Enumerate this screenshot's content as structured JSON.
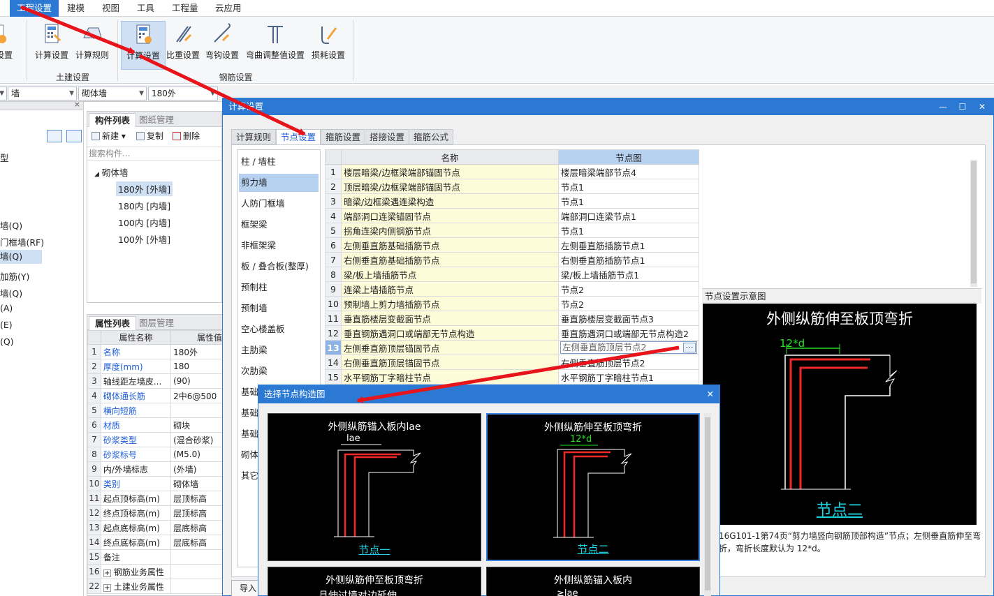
{
  "menu": [
    "工程设置",
    "建模",
    "视图",
    "工具",
    "工程量",
    "云应用"
  ],
  "ribbon": {
    "partial_left_label": "设置",
    "civil_buttons": [
      "计算设置",
      "计算规则"
    ],
    "rebar_buttons": [
      "计算设置",
      "比重设置",
      "弯钩设置",
      "弯曲调整值设置",
      "损耗设置"
    ],
    "group_civil": "土建设置",
    "group_rebar": "钢筋设置"
  },
  "combos": [
    "墙",
    "砌体墙",
    "180外"
  ],
  "left_nav": {
    "items": [
      "型",
      "墙(Q)",
      "门框墙(RF)",
      "墙(Q)",
      "加筋(Y)",
      "墙(Q)",
      "(A)",
      "(E)",
      "(Q)"
    ],
    "selected_index": 3
  },
  "component_list": {
    "tabs": [
      "构件列表",
      "图纸管理"
    ],
    "toolbar": [
      "新建",
      "复制",
      "删除"
    ],
    "search_placeholder": "搜索构件...",
    "root": "砌体墙",
    "items": [
      "180外 [外墙]",
      "180内 [内墙]",
      "100内 [内墙]",
      "100外 [外墙]"
    ],
    "selected_index": 0
  },
  "properties": {
    "tabs": [
      "属性列表",
      "图层管理"
    ],
    "headers": [
      "属性名称",
      "属性值"
    ],
    "rows": [
      {
        "n": "1",
        "name": "名称",
        "value": "180外",
        "link": true
      },
      {
        "n": "2",
        "name": "厚度(mm)",
        "value": "180",
        "link": true
      },
      {
        "n": "3",
        "name": "轴线距左墙皮...",
        "value": "(90)",
        "link": false
      },
      {
        "n": "4",
        "name": "砌体通长筋",
        "value": "2中6@500",
        "link": true
      },
      {
        "n": "5",
        "name": "横向短筋",
        "value": "",
        "link": true
      },
      {
        "n": "6",
        "name": "材质",
        "value": "砌块",
        "link": true
      },
      {
        "n": "7",
        "name": "砂浆类型",
        "value": "(混合砂浆)",
        "link": true
      },
      {
        "n": "8",
        "name": "砂浆标号",
        "value": "(M5.0)",
        "link": true
      },
      {
        "n": "9",
        "name": "内/外墙标志",
        "value": "(外墙)",
        "link": false
      },
      {
        "n": "10",
        "name": "类别",
        "value": "砌体墙",
        "link": true
      },
      {
        "n": "11",
        "name": "起点顶标高(m)",
        "value": "层顶标高",
        "link": false
      },
      {
        "n": "12",
        "name": "终点顶标高(m)",
        "value": "层顶标高",
        "link": false
      },
      {
        "n": "13",
        "name": "起点底标高(m)",
        "value": "层底标高",
        "link": false
      },
      {
        "n": "14",
        "name": "终点底标高(m)",
        "value": "层底标高",
        "link": false
      },
      {
        "n": "15",
        "name": "备注",
        "value": "",
        "link": false
      },
      {
        "n": "16",
        "name": "钢筋业务属性",
        "value": "",
        "link": false,
        "expand": true
      },
      {
        "n": "22",
        "name": "土建业务属性",
        "value": "",
        "link": false,
        "expand": true
      }
    ]
  },
  "dialog": {
    "title": "计算设置",
    "tabs": [
      "计算规则",
      "节点设置",
      "箍筋设置",
      "搭接设置",
      "箍筋公式"
    ],
    "active_tab": 1,
    "categories": [
      "柱 / 墙柱",
      "剪力墙",
      "人防门框墙",
      "框架梁",
      "非框架梁",
      "板 / 叠合板(整厚)",
      "预制柱",
      "预制墙",
      "空心楼盖板",
      "主肋梁",
      "次肋梁",
      "基础",
      "基础",
      "基础",
      "砌体",
      "其它"
    ],
    "selected_category": 1,
    "grid_headers": [
      "名称",
      "节点图"
    ],
    "rows": [
      {
        "n": "1",
        "name": "楼层暗梁/边框梁端部锚固节点",
        "node": "楼层暗梁端部节点4"
      },
      {
        "n": "2",
        "name": "顶层暗梁/边框梁端部锚固节点",
        "node": "节点1"
      },
      {
        "n": "3",
        "name": "暗梁/边框梁遇连梁构造",
        "node": "节点1"
      },
      {
        "n": "4",
        "name": "端部洞口连梁锚固节点",
        "node": "端部洞口连梁节点1"
      },
      {
        "n": "5",
        "name": "拐角连梁内侧钢筋节点",
        "node": "节点1"
      },
      {
        "n": "6",
        "name": "左侧垂直筋基础插筋节点",
        "node": "左侧垂直筋插筋节点1"
      },
      {
        "n": "7",
        "name": "右侧垂直筋基础插筋节点",
        "node": "右侧垂直筋插筋节点1"
      },
      {
        "n": "8",
        "name": "梁/板上墙插筋节点",
        "node": "梁/板上墙插筋节点1"
      },
      {
        "n": "9",
        "name": "连梁上墙插筋节点",
        "node": "节点2"
      },
      {
        "n": "10",
        "name": "预制墙上剪力墙插筋节点",
        "node": "节点2"
      },
      {
        "n": "11",
        "name": "垂直筋楼层变截面节点",
        "node": "垂直筋楼层变截面节点3"
      },
      {
        "n": "12",
        "name": "垂直钢筋遇洞口或端部无节点构造",
        "node": "垂直筋遇洞口或端部无节点构造2"
      },
      {
        "n": "13",
        "name": "左侧垂直筋顶层锚固节点",
        "node": "左侧垂直筋顶层节点2"
      },
      {
        "n": "14",
        "name": "右侧垂直筋顶层锚固节点",
        "node": "右侧垂直筋顶层节点2"
      },
      {
        "n": "15",
        "name": "水平钢筋丁字暗柱节点",
        "node": "水平钢筋丁字暗柱节点1"
      }
    ],
    "current_row": 12,
    "preview_title": "节点设置示意图",
    "preview": {
      "heading": "外侧纵筋伸至板顶弯折",
      "dim": "12*d",
      "label": "节点二"
    },
    "preview_description": "16G101-1第74页“剪力墙竖向钢筋顶部构造”节点；左侧垂直筋伸至弯折，弯折长度默认为 12*d。",
    "import_label": "导入"
  },
  "picker": {
    "title": "选择节点构造图",
    "cards": [
      {
        "title": "外侧纵筋锚入板内lae",
        "dim": "lae",
        "label": "节点一"
      },
      {
        "title": "外侧纵筋伸至板顶弯折",
        "dim": "12*d",
        "label": "节点二"
      },
      {
        "title": "外侧纵筋伸至板顶弯折",
        "subtitle": "且伸过墙对边延伸",
        "label": ""
      },
      {
        "title": "外侧纵筋锚入板内",
        "subtitle": "≥lae",
        "label": ""
      }
    ],
    "selected_card": 1
  },
  "colors": {
    "accent": "#2b79d3",
    "arrow": "#e8141b",
    "label": "#19d4e0"
  }
}
